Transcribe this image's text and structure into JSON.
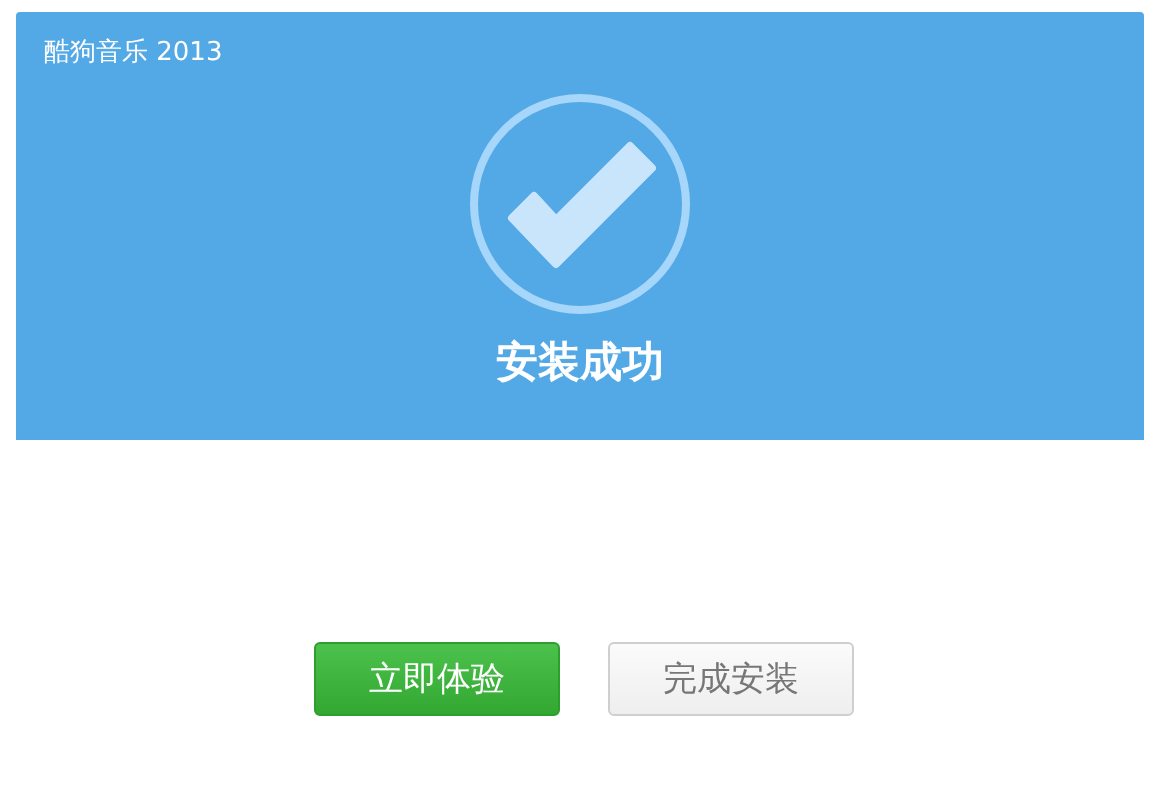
{
  "window": {
    "title": "酷狗音乐 2013"
  },
  "banner": {
    "message": "安装成功"
  },
  "buttons": [
    {
      "label": "立即体验",
      "kind": "primary"
    },
    {
      "label": "完成安装",
      "kind": "secondary"
    }
  ]
}
